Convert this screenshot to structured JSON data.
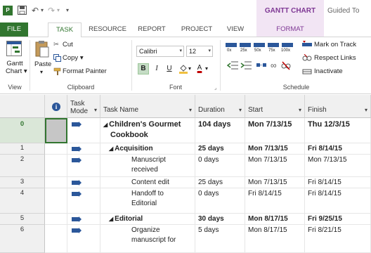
{
  "titlebar": {
    "app_icon_text": "P",
    "save_icon": "save-icon",
    "undo_glyph": "↶",
    "redo_glyph": "↷",
    "qat_more_glyph": "▾",
    "context_tab_group": "GANTT CHART TOOLS",
    "window_title": "Guided To"
  },
  "tabs": [
    {
      "label": "FILE"
    },
    {
      "label": "TASK"
    },
    {
      "label": "RESOURCE"
    },
    {
      "label": "REPORT"
    },
    {
      "label": "PROJECT"
    },
    {
      "label": "VIEW"
    },
    {
      "label": "FORMAT"
    }
  ],
  "ribbon": {
    "view": {
      "gantt_label_line1": "Gantt",
      "gantt_label_line2": "Chart ▾",
      "group": "View"
    },
    "clipboard": {
      "paste": "Paste",
      "paste_dd": "▾",
      "cut": "Cut",
      "copy": "Copy ▾",
      "format_painter": "Format Painter",
      "group": "Clipboard"
    },
    "font": {
      "family": "Calibri",
      "size": "12",
      "bold": "B",
      "italic": "I",
      "underline": "U",
      "fill_dd": "▾",
      "color_a": "A",
      "color_dd": "▾",
      "group": "Font"
    },
    "schedule": {
      "pct": [
        "0x",
        "25x",
        "50x",
        "75x",
        "100x"
      ],
      "mark_on_track": "Mark on Track",
      "respect_links": "Respect Links",
      "inactivate": "Inactivate",
      "group": "Schedule"
    },
    "colors": {
      "accent": "#31752f",
      "context": "#7e3794",
      "mode_icon": "#2b579a"
    }
  },
  "grid": {
    "headers": {
      "info": "i",
      "task_mode_line1": "Task",
      "task_mode_line2": "Mode",
      "task_name": "Task Name",
      "duration": "Duration",
      "start": "Start",
      "finish": "Finish",
      "sort_arrow": "▾"
    },
    "rows": [
      {
        "id": "0",
        "name_line1": "Children's Gourmet",
        "name_line2": "Cookbook",
        "duration": "104 days",
        "start": "Mon 7/13/15",
        "finish": "Thu 12/3/15",
        "level": 0,
        "summary": true
      },
      {
        "id": "1",
        "name_line1": "Acquisition",
        "name_line2": "",
        "duration": "25 days",
        "start": "Mon 7/13/15",
        "finish": "Fri 8/14/15",
        "level": 1,
        "summary": true
      },
      {
        "id": "2",
        "name_line1": "Manuscript",
        "name_line2": "received",
        "duration": "0 days",
        "start": "Mon 7/13/15",
        "finish": "Mon 7/13/15",
        "level": 2,
        "summary": false
      },
      {
        "id": "3",
        "name_line1": "Content edit",
        "name_line2": "",
        "duration": "25 days",
        "start": "Mon 7/13/15",
        "finish": "Fri 8/14/15",
        "level": 2,
        "summary": false
      },
      {
        "id": "4",
        "name_line1": "Handoff to",
        "name_line2": "Editorial",
        "duration": "0 days",
        "start": "Fri 8/14/15",
        "finish": "Fri 8/14/15",
        "level": 2,
        "summary": false
      },
      {
        "id": "5",
        "name_line1": "Editorial",
        "name_line2": "",
        "duration": "30 days",
        "start": "Mon 8/17/15",
        "finish": "Fri 9/25/15",
        "level": 1,
        "summary": true
      },
      {
        "id": "6",
        "name_line1": "Organize",
        "name_line2": "manuscript for",
        "duration": "5 days",
        "start": "Mon 8/17/15",
        "finish": "Fri 8/21/15",
        "level": 2,
        "summary": false
      }
    ],
    "collapse_glyph": "◢"
  }
}
